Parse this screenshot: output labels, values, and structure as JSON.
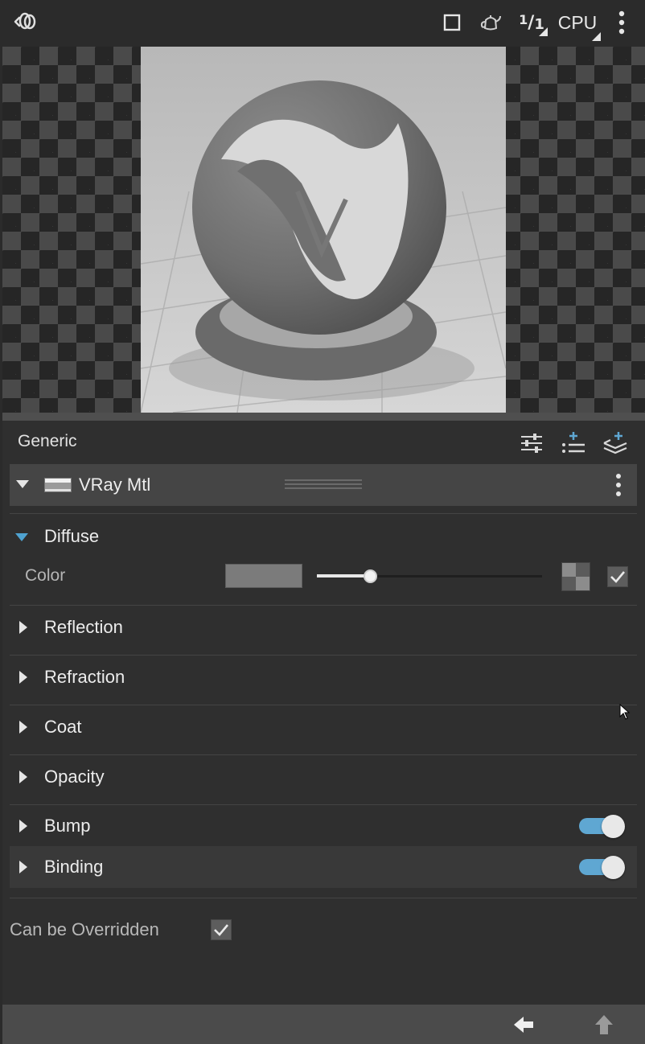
{
  "toolbar": {
    "logo_icon": "vray-logo-icon",
    "viewport_icon": "square-icon",
    "preview_object_icon": "teapot-icon",
    "ratio_numerator": "1",
    "ratio_denominator": "1",
    "engine_label": "CPU",
    "more_icon": "vertical-dots-icon"
  },
  "preview": {
    "description_visible": false
  },
  "panel": {
    "title": "Generic",
    "header_icons": [
      "sliders-icon",
      "add-list-icon",
      "add-layer-icon"
    ],
    "material": {
      "name": "VRay Mtl",
      "more_icon": "vertical-dots-icon"
    },
    "diffuse": {
      "label": "Diffuse",
      "expanded": true,
      "color_label": "Color",
      "color_value": "#7b7b7b",
      "slider_fraction": 0.24,
      "enabled": true
    },
    "sections": [
      {
        "label": "Reflection"
      },
      {
        "label": "Refraction"
      },
      {
        "label": "Coat"
      },
      {
        "label": "Opacity"
      },
      {
        "label": "Bump",
        "toggle": true
      },
      {
        "label": "Binding",
        "toggle": true
      }
    ],
    "override": {
      "label": "Can be Overridden",
      "checked": true
    }
  },
  "footer": {
    "icons": [
      "arrow-left-icon",
      "arrow-up-icon"
    ]
  },
  "colors": {
    "accent": "#5fa7d2",
    "panel_bg": "#2f2f2f",
    "header_bg": "#454545"
  }
}
